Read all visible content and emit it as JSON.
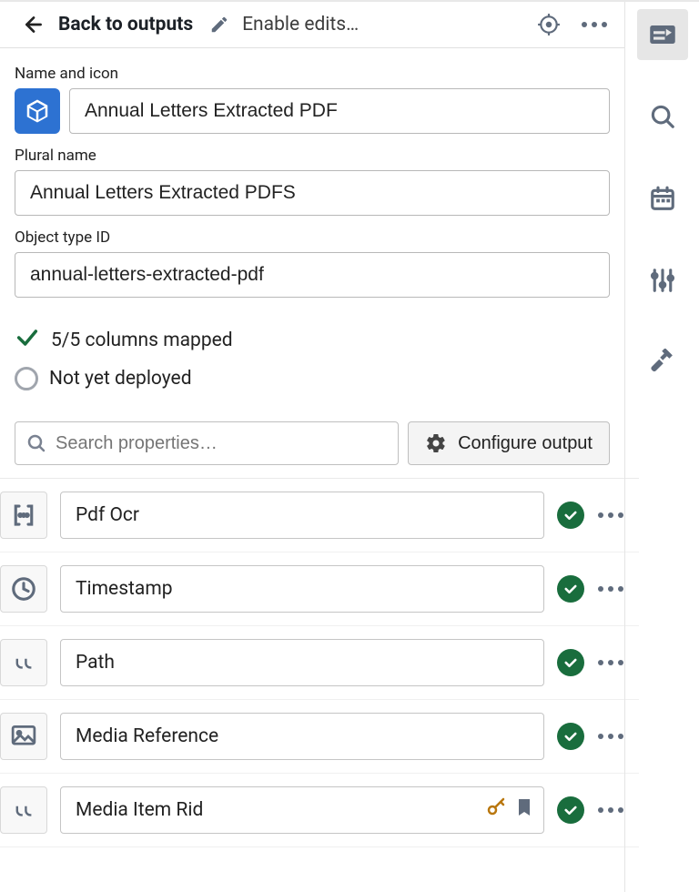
{
  "topbar": {
    "back_label": "Back to outputs",
    "enable_label": "Enable edits…"
  },
  "fields": {
    "name_label": "Name and icon",
    "name_value": "Annual Letters Extracted PDF",
    "plural_label": "Plural name",
    "plural_value": "Annual Letters Extracted PDFS",
    "id_label": "Object type ID",
    "id_value": "annual-letters-extracted-pdf"
  },
  "status": {
    "mapped": "5/5 columns mapped",
    "deployed": "Not yet deployed"
  },
  "search": {
    "placeholder": "Search properties…",
    "configure_label": "Configure output"
  },
  "properties": [
    {
      "name": "Pdf Ocr",
      "type": "array",
      "key": false
    },
    {
      "name": "Timestamp",
      "type": "time",
      "key": false
    },
    {
      "name": "Path",
      "type": "string",
      "key": false
    },
    {
      "name": "Media Reference",
      "type": "image",
      "key": false
    },
    {
      "name": "Media Item Rid",
      "type": "string",
      "key": true
    }
  ],
  "sidebar": {
    "items": [
      "panel-icon",
      "search-icon",
      "calendar-icon",
      "sliders-icon",
      "hammer-icon"
    ]
  }
}
